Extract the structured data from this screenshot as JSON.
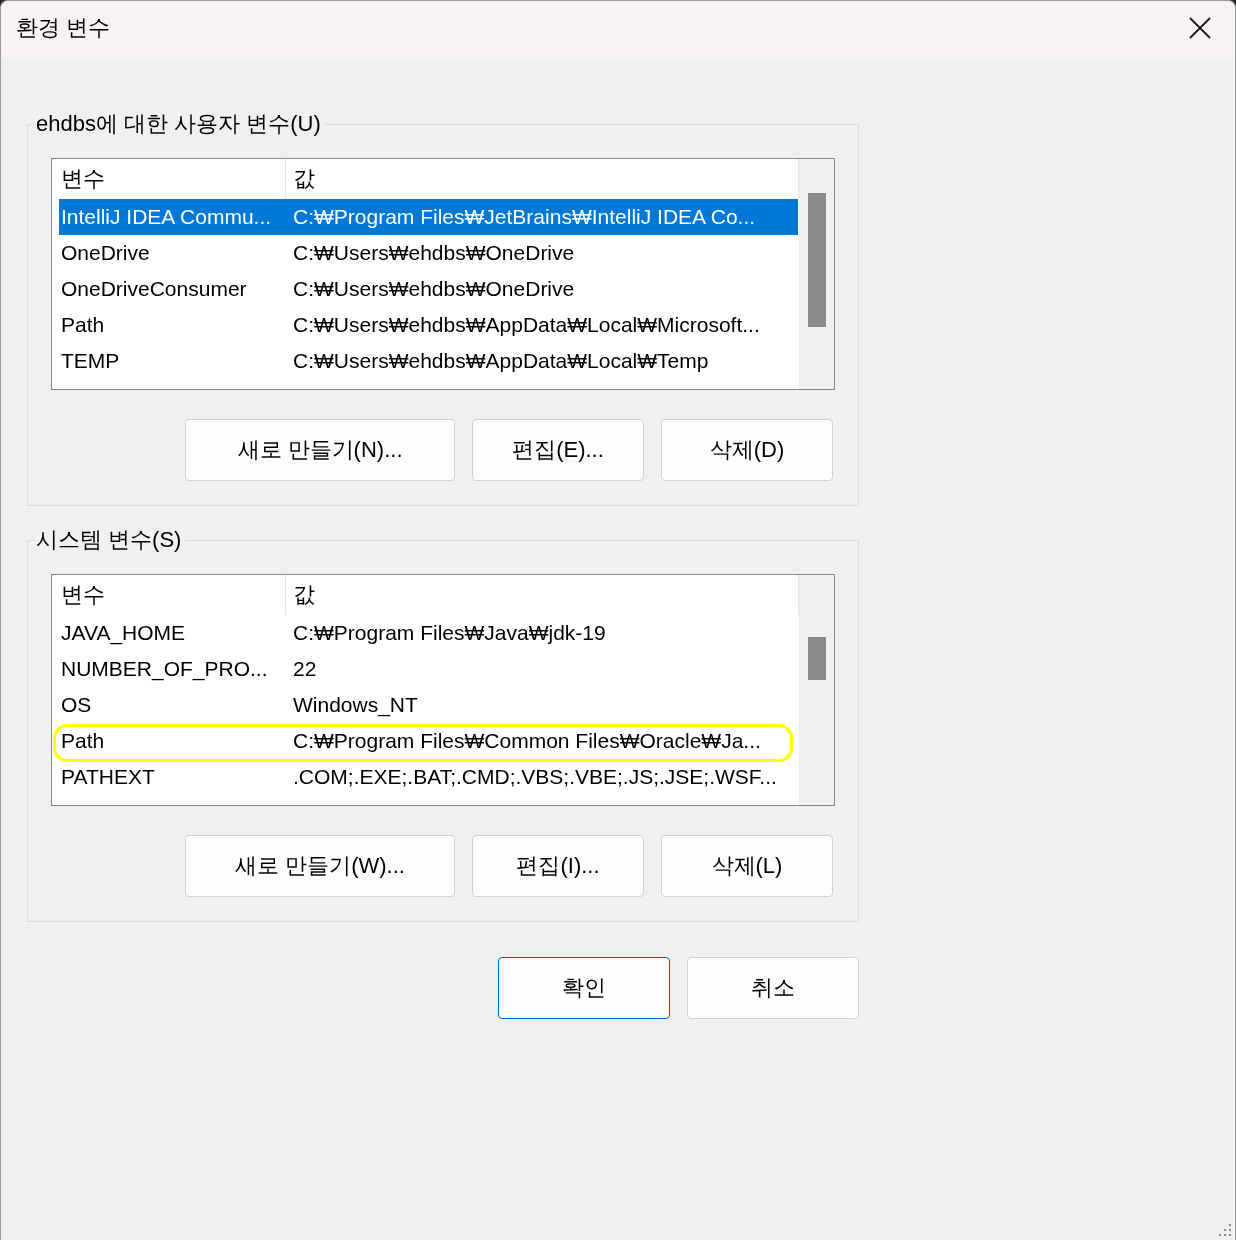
{
  "window": {
    "title": "환경 변수"
  },
  "user_variables": {
    "label": "ehdbs에 대한 사용자 변수(U)",
    "columns": [
      "변수",
      "값"
    ],
    "rows": [
      {
        "name": "IntelliJ IDEA Commu...",
        "value": "C:₩Program Files₩JetBrains₩IntelliJ IDEA Co...",
        "selected": true,
        "circled": false
      },
      {
        "name": "OneDrive",
        "value": "C:₩Users₩ehdbs₩OneDrive",
        "selected": false,
        "circled": false
      },
      {
        "name": "OneDriveConsumer",
        "value": "C:₩Users₩ehdbs₩OneDrive",
        "selected": false,
        "circled": false
      },
      {
        "name": "Path",
        "value": "C:₩Users₩ehdbs₩AppData₩Local₩Microsoft...",
        "selected": false,
        "circled": false
      },
      {
        "name": "TEMP",
        "value": "C:₩Users₩ehdbs₩AppData₩Local₩Temp",
        "selected": false,
        "circled": false
      }
    ],
    "buttons": [
      "새로 만들기(N)...",
      "편집(E)...",
      "삭제(D)"
    ]
  },
  "system_variables": {
    "label": "시스템 변수(S)",
    "columns": [
      "변수",
      "값"
    ],
    "rows": [
      {
        "name": "JAVA_HOME",
        "value": "C:₩Program Files₩Java₩jdk-19",
        "selected": false,
        "circled": false
      },
      {
        "name": "NUMBER_OF_PRO...",
        "value": "22",
        "selected": false,
        "circled": false
      },
      {
        "name": "OS",
        "value": "Windows_NT",
        "selected": false,
        "circled": false
      },
      {
        "name": "Path",
        "value": "C:₩Program Files₩Common Files₩Oracle₩Ja...",
        "selected": false,
        "circled": true
      },
      {
        "name": "PATHEXT",
        "value": ".COM;.EXE;.BAT;.CMD;.VBS;.VBE;.JS;.JSE;.WSF...",
        "selected": false,
        "circled": false
      }
    ],
    "buttons": [
      "새로 만들기(W)...",
      "편집(I)...",
      "삭제(L)"
    ]
  },
  "dialog_buttons": [
    {
      "label": "확인",
      "default": true
    },
    {
      "label": "취소",
      "default": false
    }
  ]
}
